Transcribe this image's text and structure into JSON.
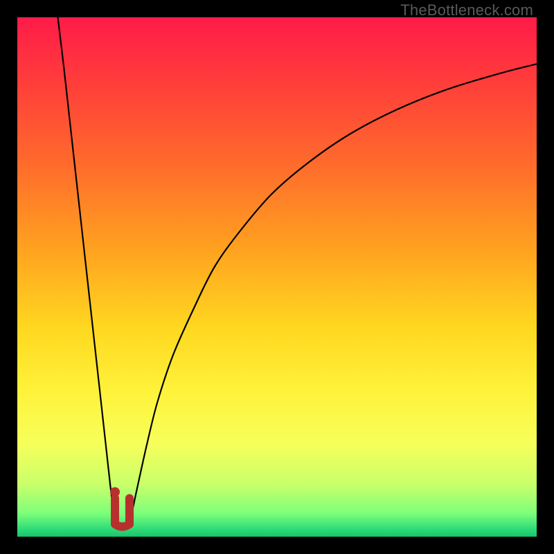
{
  "watermark": "TheBottleneck.com",
  "colors": {
    "background_black": "#000000",
    "curve_stroke": "#000000",
    "marker_fill": "#b8302e",
    "gradient_stops": [
      {
        "offset": 0.0,
        "color": "#ff1b49"
      },
      {
        "offset": 0.12,
        "color": "#ff3c3b"
      },
      {
        "offset": 0.28,
        "color": "#ff6a2c"
      },
      {
        "offset": 0.45,
        "color": "#ffa31f"
      },
      {
        "offset": 0.6,
        "color": "#ffd820"
      },
      {
        "offset": 0.72,
        "color": "#fff23a"
      },
      {
        "offset": 0.82,
        "color": "#f7ff5a"
      },
      {
        "offset": 0.9,
        "color": "#c8ff6a"
      },
      {
        "offset": 0.955,
        "color": "#7dff7a"
      },
      {
        "offset": 0.985,
        "color": "#2fdc78"
      },
      {
        "offset": 1.0,
        "color": "#18c46a"
      }
    ]
  },
  "chart_data": {
    "type": "line",
    "title": "",
    "xlabel": "",
    "ylabel": "",
    "xlim": [
      0,
      100
    ],
    "ylim": [
      0,
      100
    ],
    "grid": false,
    "series": [
      {
        "name": "left-branch",
        "x": [
          7.8,
          9,
          10,
          11,
          12,
          13,
          14,
          15,
          16,
          17,
          18,
          18.8
        ],
        "y": [
          100,
          90,
          81,
          72,
          63,
          54,
          45,
          36,
          27,
          18,
          9,
          2.4
        ]
      },
      {
        "name": "right-branch",
        "x": [
          21.6,
          23,
          25,
          27,
          30,
          34,
          38,
          43,
          49,
          56,
          64,
          73,
          83,
          94,
          100
        ],
        "y": [
          2.4,
          9,
          18,
          26,
          35,
          44,
          52,
          59,
          66,
          72,
          77.5,
          82.2,
          86.2,
          89.5,
          91
        ]
      }
    ],
    "marker": {
      "name": "u-marker",
      "x_center": 20.2,
      "x_left_lobe": 18.8,
      "x_right_lobe": 21.6,
      "y": 2.4,
      "width_pct": 3.5,
      "height_pct": 5.0
    }
  }
}
